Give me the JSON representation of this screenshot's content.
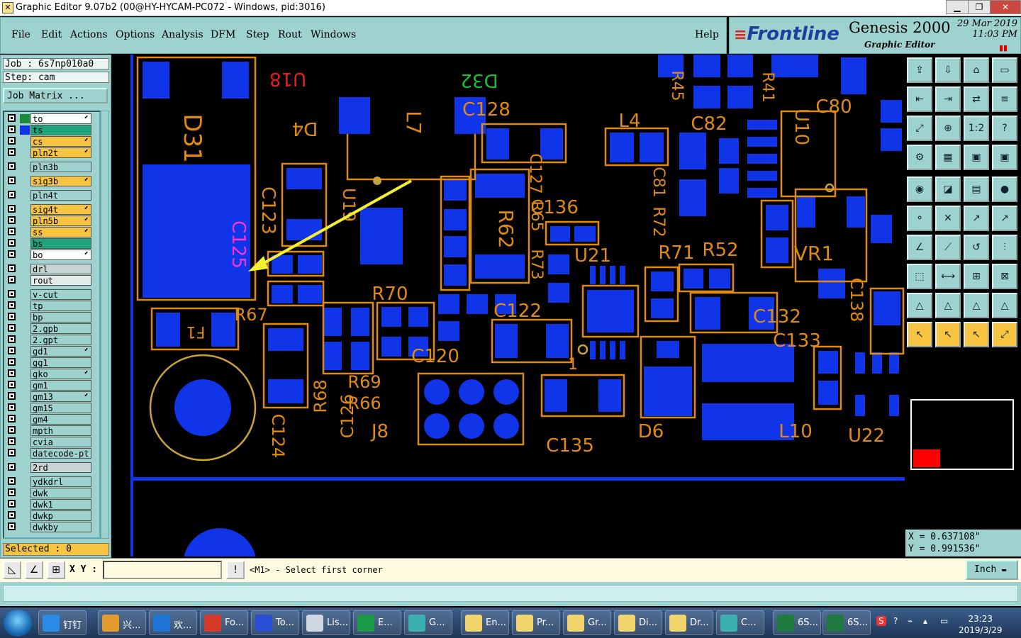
{
  "window": {
    "title": "Graphic Editor 9.07b2 (00@HY-HYCAM-PC072 - Windows, pid:3016)",
    "controls": [
      "▁",
      "❐",
      "✕"
    ]
  },
  "menu": {
    "items": [
      "File",
      "Edit",
      "Actions",
      "Options",
      "Analysis",
      "DFM",
      "Step",
      "Rout",
      "Windows"
    ],
    "help": "Help"
  },
  "brand": {
    "logo": "Frontline",
    "product": "Genesis 2000",
    "subtitle": "Graphic Editor",
    "date": "29 Mar 2019",
    "time": "11:03 PM"
  },
  "job": {
    "job_line": "Job : 6s7np010a0",
    "step_line": "Step: cam",
    "matrix_button": "Job Matrix ..."
  },
  "layers": [
    {
      "name": "to",
      "swatch": "#1c8a3a",
      "bg": "#ffffff",
      "mark": "⬋"
    },
    {
      "name": "ts",
      "swatch": "#1033e8",
      "bg": "#1fa37a",
      "mark": ""
    },
    {
      "name": "cs",
      "swatch": "",
      "bg": "#f6c440",
      "mark": "⬋"
    },
    {
      "name": "pln2t",
      "swatch": "",
      "bg": "#f6c440",
      "mark": "⬋"
    },
    {
      "name": "pln3b",
      "swatch": "",
      "bg": "#9ed2ce",
      "mark": ""
    },
    {
      "name": "sig3b",
      "swatch": "",
      "bg": "#f6c440",
      "mark": "⬋"
    },
    {
      "name": "pln4t",
      "swatch": "",
      "bg": "#9ed2ce",
      "mark": ""
    },
    {
      "name": "sig4t",
      "swatch": "",
      "bg": "#f6c440",
      "mark": "⬋"
    },
    {
      "name": "pln5b",
      "swatch": "",
      "bg": "#f6c440",
      "mark": "⬋"
    },
    {
      "name": "ss",
      "swatch": "",
      "bg": "#f6c440",
      "mark": "⬋"
    },
    {
      "name": "bs",
      "swatch": "",
      "bg": "#1fa37a",
      "mark": ""
    },
    {
      "name": "bo",
      "swatch": "",
      "bg": "#ffffff",
      "mark": "⬋"
    },
    {
      "name": "drl",
      "swatch": "",
      "bg": "#c8d4d4",
      "mark": ""
    },
    {
      "name": "rout",
      "swatch": "",
      "bg": "#e2eaea",
      "mark": ""
    },
    {
      "name": "v-cut",
      "swatch": "",
      "bg": "#9ed2ce",
      "mark": ""
    },
    {
      "name": "tp",
      "swatch": "",
      "bg": "#9ed2ce",
      "mark": ""
    },
    {
      "name": "bp",
      "swatch": "",
      "bg": "#9ed2ce",
      "mark": ""
    },
    {
      "name": "2.gpb",
      "swatch": "",
      "bg": "#9ed2ce",
      "mark": ""
    },
    {
      "name": "2.gpt",
      "swatch": "",
      "bg": "#9ed2ce",
      "mark": ""
    },
    {
      "name": "gd1",
      "swatch": "",
      "bg": "#9ed2ce",
      "mark": "⬋"
    },
    {
      "name": "gg1",
      "swatch": "",
      "bg": "#9ed2ce",
      "mark": ""
    },
    {
      "name": "gko",
      "swatch": "",
      "bg": "#9ed2ce",
      "mark": "⬋"
    },
    {
      "name": "gm1",
      "swatch": "",
      "bg": "#9ed2ce",
      "mark": ""
    },
    {
      "name": "gm13",
      "swatch": "",
      "bg": "#9ed2ce",
      "mark": "⬋"
    },
    {
      "name": "gm15",
      "swatch": "",
      "bg": "#9ed2ce",
      "mark": ""
    },
    {
      "name": "gm4",
      "swatch": "",
      "bg": "#9ed2ce",
      "mark": ""
    },
    {
      "name": "mpth",
      "swatch": "",
      "bg": "#9ed2ce",
      "mark": ""
    },
    {
      "name": "cvia",
      "swatch": "",
      "bg": "#9ed2ce",
      "mark": ""
    },
    {
      "name": "datecode-pt",
      "swatch": "",
      "bg": "#9ed2ce",
      "mark": ""
    },
    {
      "name": "2rd",
      "swatch": "",
      "bg": "#c8d4d4",
      "mark": ""
    },
    {
      "name": "ydkdrl",
      "swatch": "",
      "bg": "#9ed2ce",
      "mark": ""
    },
    {
      "name": "dwk",
      "swatch": "",
      "bg": "#9ed2ce",
      "mark": ""
    },
    {
      "name": "dwk1",
      "swatch": "",
      "bg": "#9ed2ce",
      "mark": ""
    },
    {
      "name": "dwkp",
      "swatch": "",
      "bg": "#9ed2ce",
      "mark": ""
    },
    {
      "name": "dwkby",
      "swatch": "",
      "bg": "#9ed2ce",
      "mark": ""
    }
  ],
  "selected_text": "Selected : 0",
  "pcb": {
    "designators": [
      "D31",
      "C123",
      "C125",
      "F1",
      "R67",
      "C124",
      "R68",
      "C126",
      "R69",
      "R66",
      "J8",
      "U18",
      "U19",
      "D4",
      "L7",
      "D32",
      "C128",
      "C127",
      "R65",
      "R73",
      "R62",
      "C136",
      "U21",
      "R70",
      "C122",
      "C120",
      "1",
      "C135",
      "L4",
      "R45",
      "C82",
      "C81",
      "R72",
      "R71",
      "R52",
      "U10",
      "C80",
      "R41",
      "VR1",
      "C132",
      "C133",
      "C138",
      "D6",
      "L10",
      "U22"
    ]
  },
  "tools": [
    "⇪",
    "⇩",
    "⌂",
    "▭",
    "⇤",
    "⇥",
    "⇄",
    "≡",
    "⤢",
    "⊕",
    "1:2",
    "?",
    "⚙",
    "▦",
    "▣",
    "▣",
    "◉",
    "◪",
    "▤",
    "●",
    "⚬",
    "✕",
    "↗",
    "↗",
    "∠",
    "⟋",
    "↺",
    "⫶",
    "⬚",
    "⟷",
    "⊞",
    "⊠",
    "△",
    "△",
    "△",
    "△",
    "↖",
    "↖",
    "↖",
    "⤢"
  ],
  "coords": {
    "x": "X = 0.637108\"",
    "y": "Y = 0.991536\""
  },
  "command": {
    "xy_label": "X Y :",
    "xy_value": "",
    "prompt": "<M1> - Select first corner",
    "unit": "Inch",
    "alert": "!"
  },
  "taskbar": {
    "items": [
      {
        "label": "钉钉",
        "color": "#2a8be6"
      },
      {
        "label": "兴...",
        "color": "#e39b2d"
      },
      {
        "label": "欢...",
        "color": "#1d74d6"
      },
      {
        "label": "Fo...",
        "color": "#d63a2a"
      },
      {
        "label": "To...",
        "color": "#2a4fd6"
      },
      {
        "label": "Lis...",
        "color": "#cfd6e0"
      },
      {
        "label": "E...",
        "color": "#1b9a46"
      },
      {
        "label": "G...",
        "color": "#3ab0b0"
      },
      {
        "label": "En...",
        "color": "#f0d46b"
      },
      {
        "label": "Pr...",
        "color": "#f0d46b"
      },
      {
        "label": "Gr...",
        "color": "#f0d46b"
      },
      {
        "label": "Di...",
        "color": "#f0d46b"
      },
      {
        "label": "Dr...",
        "color": "#f0d46b"
      },
      {
        "label": "C...",
        "color": "#3ab0b0"
      },
      {
        "label": "6S...",
        "color": "#1e7a3e"
      },
      {
        "label": "6S...",
        "color": "#1e7a3e"
      }
    ],
    "clock_time": "23:23",
    "clock_date": "2019/3/29"
  },
  "colors": {
    "pad": "#1034e8",
    "outline": "#e08a16",
    "text_silk": "#e08a16",
    "panel": "#9ed2ce",
    "arrow": "#f4ef30"
  }
}
